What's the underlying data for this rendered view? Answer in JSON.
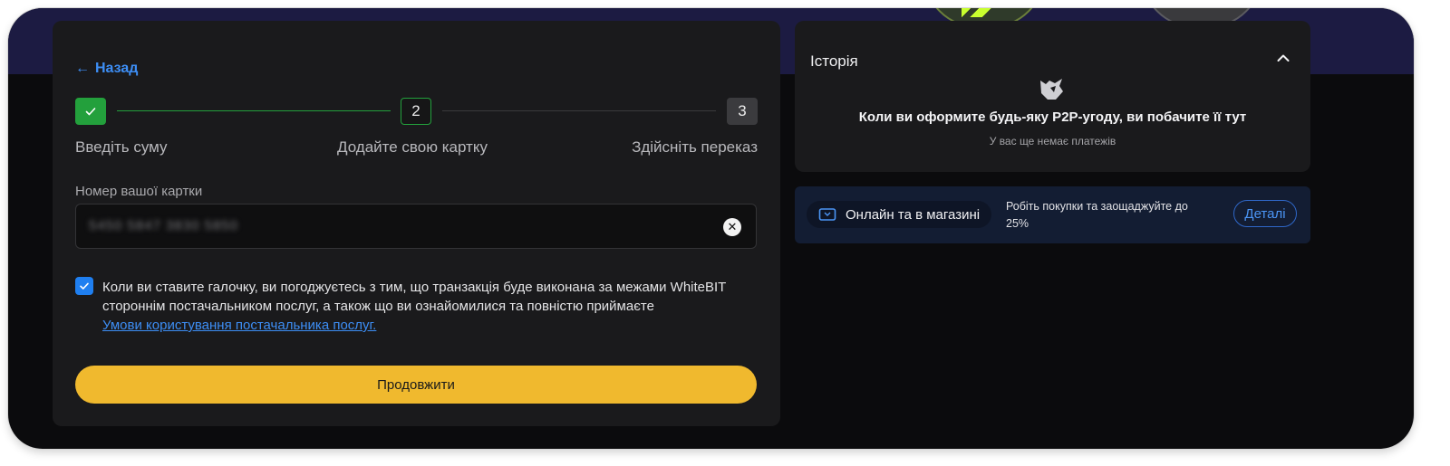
{
  "form": {
    "back_label": "Назад",
    "steps": [
      {
        "number": "",
        "label": "Введіть суму",
        "state": "done"
      },
      {
        "number": "2",
        "label": "Додайте свою картку",
        "state": "active"
      },
      {
        "number": "3",
        "label": "Здійсніть переказ",
        "state": "pending"
      }
    ],
    "card_field": {
      "label": "Номер вашої картки",
      "value": "5450 5847 3830 5850"
    },
    "consent": {
      "checked": true,
      "text": "Коли ви ставите галочку, ви погоджуєтесь з тим, що транзакція буде виконана за межами WhiteBIT стороннім постачальником послуг, а також що ви ознайомилися та повністю приймаєте",
      "link_text": "Умови користування постачальника послуг."
    },
    "continue_label": "Продовжити"
  },
  "history": {
    "title": "Історія",
    "empty_title": "Коли ви оформите будь-яку P2P-угоду, ви побачите її тут",
    "empty_subtitle": "У вас ще немає платежів"
  },
  "promo": {
    "pill_label": "Онлайн та в магазині",
    "description": "Робіть покупки та заощаджуйте до 25%",
    "details_label": "Деталі"
  },
  "colors": {
    "accent": "#3d8ef5",
    "success": "#23a03c",
    "primary_button": "#f0b92e",
    "banner": "#1c1b42"
  },
  "icons": {
    "back": "arrow-left-icon",
    "step_done": "check-icon",
    "clear": "close-icon",
    "collapse": "chevron-up-icon",
    "empty": "mascot-icon",
    "promo": "card-icon"
  }
}
